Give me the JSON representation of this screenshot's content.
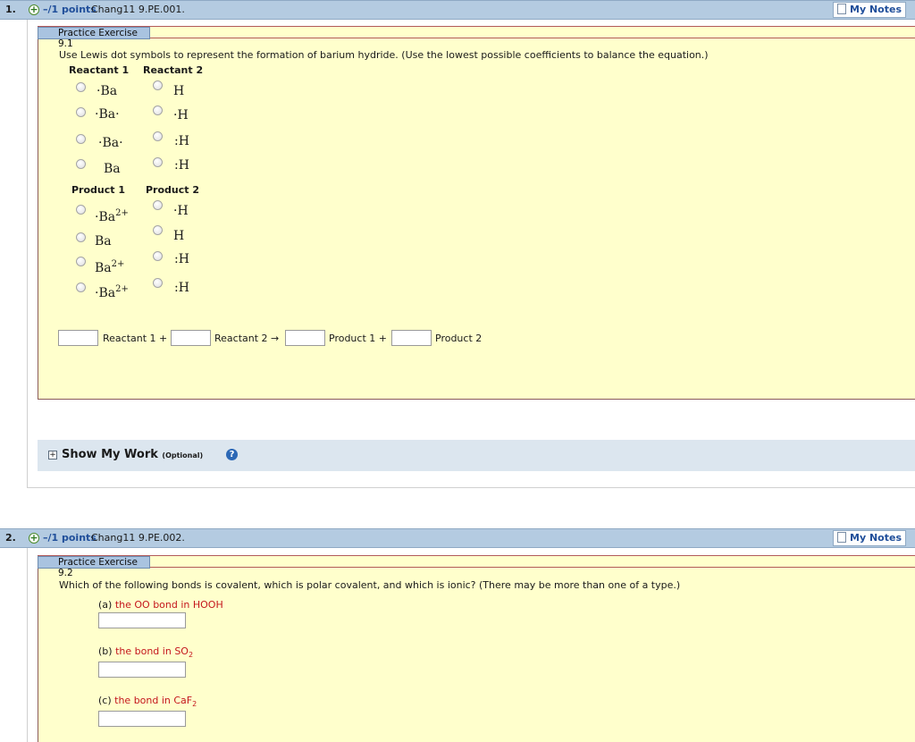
{
  "q1": {
    "number": "1.",
    "points": "–/1 points",
    "code": "Chang11 9.PE.001.",
    "my_notes": "My Notes",
    "exercise_title": "Practice Exercise 9.1",
    "prompt": "Use Lewis dot symbols to represent the formation of barium hydride. (Use the lowest possible coefficients to balance the equation.)",
    "reactant1_head": "Reactant 1",
    "reactant2_head": "Reactant 2",
    "product1_head": "Product 1",
    "product2_head": "Product 2",
    "reactant1_options": [
      "·Ba",
      "·Ba·",
      "·Ba·",
      "Ba"
    ],
    "reactant2_options": [
      "H",
      "·H",
      ":H",
      ":H"
    ],
    "product1_options": [
      "·Ba",
      "Ba",
      "Ba",
      "·Ba"
    ],
    "product1_charge": "2+",
    "product2_options": [
      "·H",
      "H",
      ":H",
      ":H"
    ],
    "eq_reactant1": "Reactant 1 +",
    "eq_reactant2": "Reactant 2 →",
    "eq_product1": "Product 1 +",
    "eq_product2": "Product 2",
    "show_work": "Show My Work",
    "optional": "(Optional)",
    "help": "?"
  },
  "q2": {
    "number": "2.",
    "points": "–/1 points",
    "code": "Chang11 9.PE.002.",
    "my_notes": "My Notes",
    "exercise_title": "Practice Exercise 9.2",
    "prompt": "Which of the following bonds is covalent, which is polar covalent, and which is ionic? (There may be more than one of a type.)",
    "a_label": "(a)",
    "a_text": "the OO bond in HOOH",
    "b_label": "(b)",
    "b_text": "the bond in SO",
    "b_sub": "2",
    "c_label": "(c)",
    "c_text": "the bond in CaF",
    "c_sub": "2"
  },
  "colors": {
    "header": "#b4cbe1",
    "panel": "#ffffcc",
    "link": "#1f4e9a",
    "accent_red": "#c4161c"
  }
}
